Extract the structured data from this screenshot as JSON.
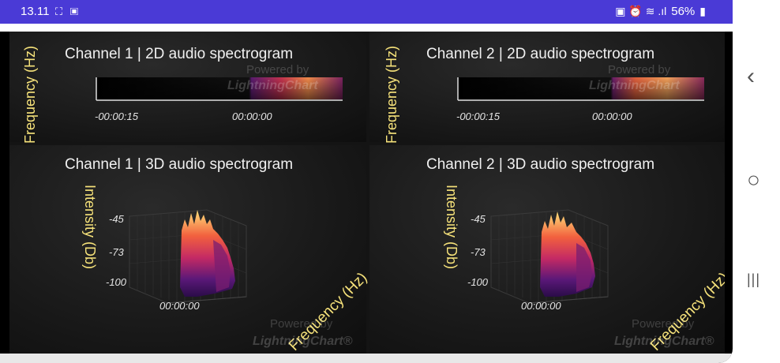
{
  "status_bar": {
    "time": "13.11",
    "left_icons": "⛶ ▣",
    "battery": "56%",
    "right_icons": "▣ ⏰ ≋ .ıl"
  },
  "charts": [
    {
      "title": "Channel 1 | 2D audio spectrogram",
      "ylabel": "Frequency (Hz)",
      "ticks": [
        "-00:00:15",
        "00:00:00"
      ],
      "watermark_top": "Powered by",
      "watermark_bottom": "LightningChart"
    },
    {
      "title": "Channel 2 | 2D audio spectrogram",
      "ylabel": "Frequency (Hz)",
      "ticks": [
        "-00:00:15",
        "00:00:00"
      ],
      "watermark_top": "Powered by",
      "watermark_bottom": "LightningChart"
    },
    {
      "title": "Channel 1 | 3D audio spectrogram",
      "ylabel": "Intensity (Db)",
      "zlabel": "Frequency (Hz)",
      "y_ticks": [
        "-45",
        "-73",
        "-100"
      ],
      "x_tick": "00:00:00",
      "watermark_top": "Powered by",
      "watermark_bottom": "LightningChart®"
    },
    {
      "title": "Channel 2 | 3D audio spectrogram",
      "ylabel": "Intensity (Db)",
      "zlabel": "Frequency (Hz)",
      "y_ticks": [
        "-45",
        "-73",
        "-100"
      ],
      "x_tick": "00:00:00",
      "watermark_top": "Powered by",
      "watermark_bottom": "LightningChart®"
    }
  ],
  "nav": {
    "back": "‹",
    "home": "○",
    "recents": "|||"
  },
  "colors": {
    "statusbar": "#4a3ad6",
    "label_yellow": "#f6e27a",
    "heat_hot": "#ffe27a",
    "heat_mid": "#e8324a",
    "heat_low": "#4b1578"
  }
}
